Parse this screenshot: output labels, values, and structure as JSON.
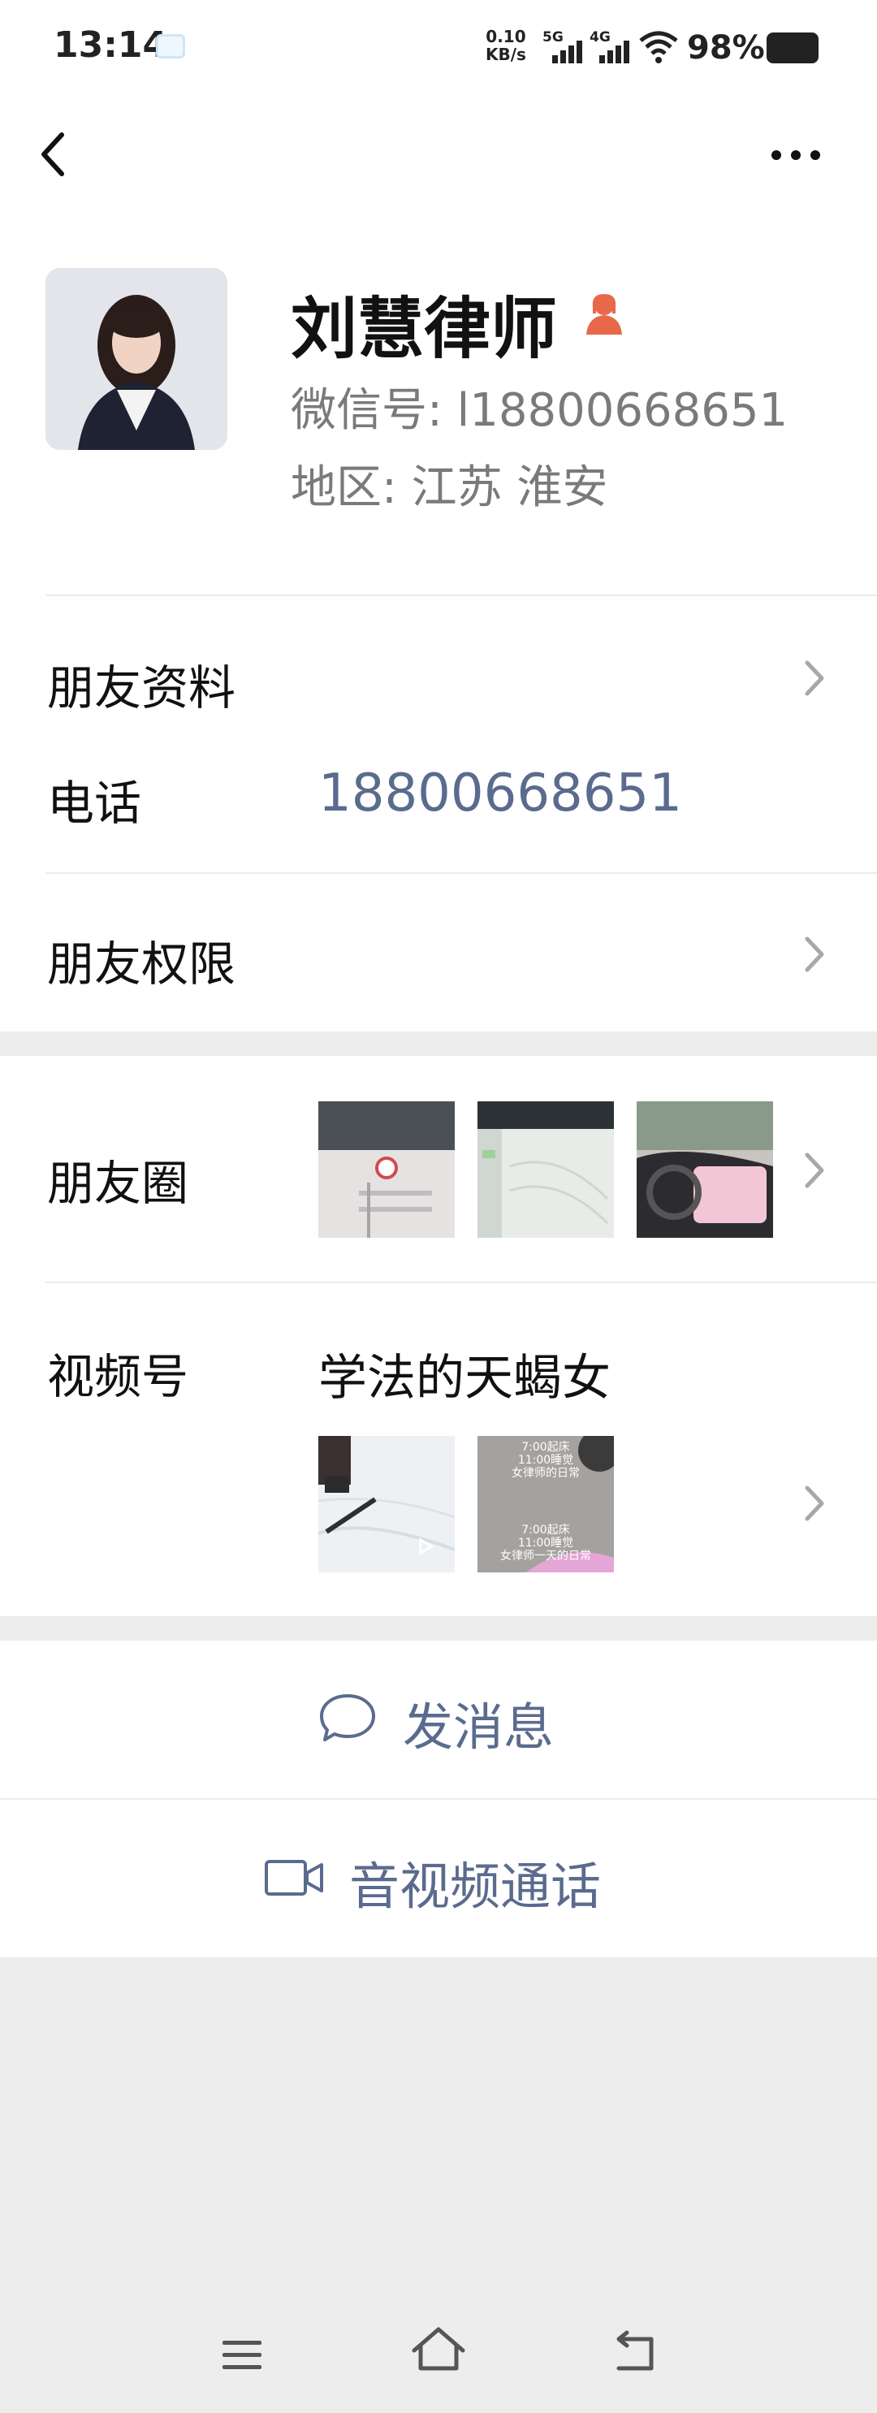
{
  "status_bar": {
    "time": "13:14",
    "net_speed_value": "0.10",
    "net_speed_unit": "KB/s",
    "sim1_label": "5G",
    "sim2_label": "4G",
    "battery": "98%"
  },
  "header": {
    "back_icon": "chevron-left-icon",
    "more_icon": "more-dots-icon"
  },
  "profile": {
    "name": "刘慧律师",
    "wechat_id": "微信号: l18800668651",
    "region": "地区: 江苏  淮安",
    "gender_icon": "female-icon",
    "accent_color": "#e8684a"
  },
  "rows": {
    "friend_info": "朋友资料",
    "phone_label": "电话",
    "phone_value": "18800668651",
    "permissions": "朋友权限",
    "moments": "朋友圈",
    "channels": "视频号",
    "channel_name": "学法的天蝎女"
  },
  "channel_thumb_text": {
    "line1": "7:00起床",
    "line2": "11:00睡觉",
    "line3": "女律师的日常",
    "line4": "7:00起床",
    "line5": "11:00睡觉",
    "line6": "女律师一天的日常"
  },
  "actions": {
    "send_message": "发消息",
    "video_call": "音视频通话"
  },
  "colors": {
    "link": "#5a6b8e",
    "background": "#ededed"
  }
}
